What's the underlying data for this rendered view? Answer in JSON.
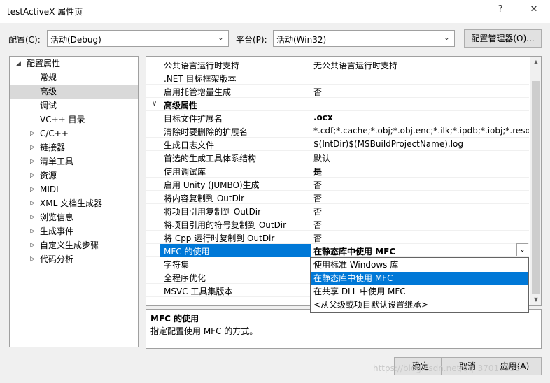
{
  "window": {
    "title": "testActiveX 属性页",
    "help": "?",
    "close": "✕"
  },
  "config": {
    "config_label": "配置(C):",
    "config_value": "活动(Debug)",
    "platform_label": "平台(P):",
    "platform_value": "活动(Win32)",
    "manager_button": "配置管理器(O)..."
  },
  "tree": {
    "items": [
      {
        "label": "配置属性"
      },
      {
        "label": "常规"
      },
      {
        "label": "高级"
      },
      {
        "label": "调试"
      },
      {
        "label": "VC++ 目录"
      },
      {
        "label": "C/C++"
      },
      {
        "label": "链接器"
      },
      {
        "label": "清单工具"
      },
      {
        "label": "资源"
      },
      {
        "label": "MIDL"
      },
      {
        "label": "XML 文档生成器"
      },
      {
        "label": "浏览信息"
      },
      {
        "label": "生成事件"
      },
      {
        "label": "自定义生成步骤"
      },
      {
        "label": "代码分析"
      }
    ]
  },
  "grid": {
    "rows": [
      {
        "name": "公共语言运行时支持",
        "value": "无公共语言运行时支持"
      },
      {
        "name": ".NET 目标框架版本",
        "value": ""
      },
      {
        "name": "启用托管增量生成",
        "value": "否"
      },
      {
        "name": "高级属性",
        "value": ""
      },
      {
        "name": "目标文件扩展名",
        "value": ".ocx"
      },
      {
        "name": "清除时要删除的扩展名",
        "value": "*.cdf;*.cache;*.obj;*.obj.enc;*.ilk;*.ipdb;*.iobj;*.resources;*"
      },
      {
        "name": "生成日志文件",
        "value": "$(IntDir)$(MSBuildProjectName).log"
      },
      {
        "name": "首选的生成工具体系结构",
        "value": "默认"
      },
      {
        "name": "使用调试库",
        "value": "是"
      },
      {
        "name": "启用 Unity (JUMBO)生成",
        "value": "否"
      },
      {
        "name": "将内容复制到 OutDir",
        "value": "否"
      },
      {
        "name": "将项目引用复制到 OutDir",
        "value": "否"
      },
      {
        "name": "将项目引用的符号复制到 OutDir",
        "value": "否"
      },
      {
        "name": "将 Cpp 运行时复制到 OutDir",
        "value": "否"
      },
      {
        "name": "MFC 的使用",
        "value": "在静态库中使用 MFC"
      },
      {
        "name": "字符集",
        "value": ""
      },
      {
        "name": "全程序优化",
        "value": ""
      },
      {
        "name": "MSVC 工具集版本",
        "value": ""
      }
    ]
  },
  "dropdown": {
    "options": [
      "使用标准 Windows 库",
      "在静态库中使用 MFC",
      "在共享 DLL 中使用 MFC",
      "<从父级或项目默认设置继承>"
    ],
    "selected": "在静态库中使用 MFC"
  },
  "description": {
    "title": "MFC 的使用",
    "text": "指定配置使用 MFC 的方式。"
  },
  "buttons": {
    "ok": "确定",
    "cancel": "取消",
    "apply": "应用(A)"
  },
  "watermark": "https://blog.csdn.net/qq_37017335"
}
